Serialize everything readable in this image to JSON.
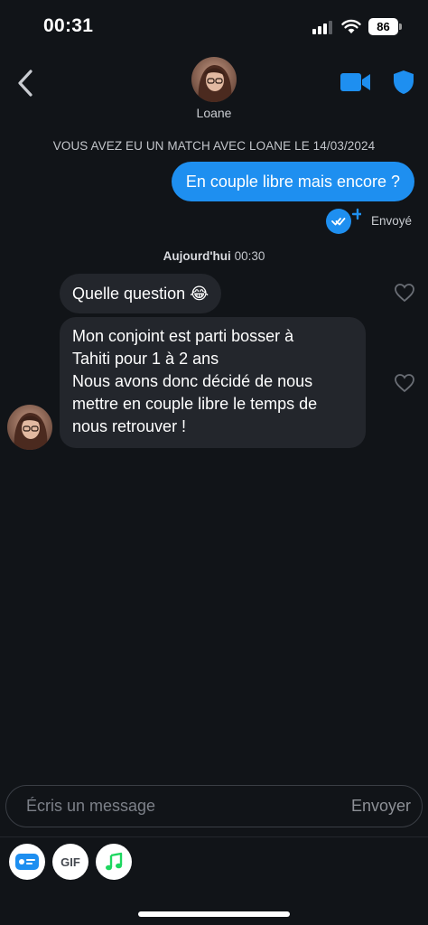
{
  "status_bar": {
    "time": "00:31",
    "battery": "86",
    "icons": [
      "signal-icon",
      "wifi-icon",
      "battery-icon"
    ]
  },
  "header": {
    "back_icon": "chevron-left-icon",
    "contact_name": "Loane",
    "video_icon": "video-camera-icon",
    "safety_icon": "shield-icon"
  },
  "conversation": {
    "match_banner": "VOUS AVEZ EU UN MATCH AVEC LOANE LE 14/03/2024",
    "sent_messages": [
      {
        "text": "En couple libre mais encore ?",
        "status": "Envoyé"
      }
    ],
    "timestamp": {
      "day": "Aujourd'hui",
      "time": "00:30"
    },
    "received_messages": [
      {
        "text": "Quelle question 😂"
      },
      {
        "text": "Mon conjoint est parti bosser à\nTahiti pour 1 à 2 ans\nNous avons donc décidé de nous\nmettre en couple libre le temps de\nnous retrouver !"
      }
    ]
  },
  "composer": {
    "placeholder": "Écris un message",
    "send_label": "Envoyer",
    "tools": [
      {
        "icon": "sticker-card-icon"
      },
      {
        "label": "GIF"
      },
      {
        "icon": "music-note-icon"
      }
    ]
  },
  "colors": {
    "background": "#111418",
    "sent_bubble": "#1e8ff0",
    "received_bubble": "#23262c",
    "accent": "#1e8ff0",
    "music": "#1ed760"
  }
}
